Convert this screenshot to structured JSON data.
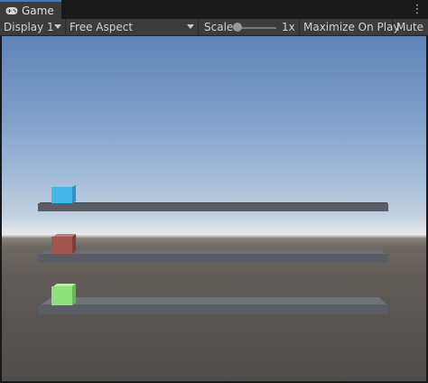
{
  "tab": {
    "label": "Game",
    "icon": "gamepad-icon"
  },
  "menu_icon": "kebab-menu-icon",
  "toolbar": {
    "display": "Display 1",
    "aspect": "Free Aspect",
    "scale_label": "Scale",
    "scale_value": "1x",
    "maximize_label": "Maximize On Play",
    "mute_label": "Mute"
  },
  "scene": {
    "cube_colors": [
      "#45b8ea",
      "#a35650",
      "#8ee07a"
    ],
    "platform_color": "#5a5e64"
  }
}
